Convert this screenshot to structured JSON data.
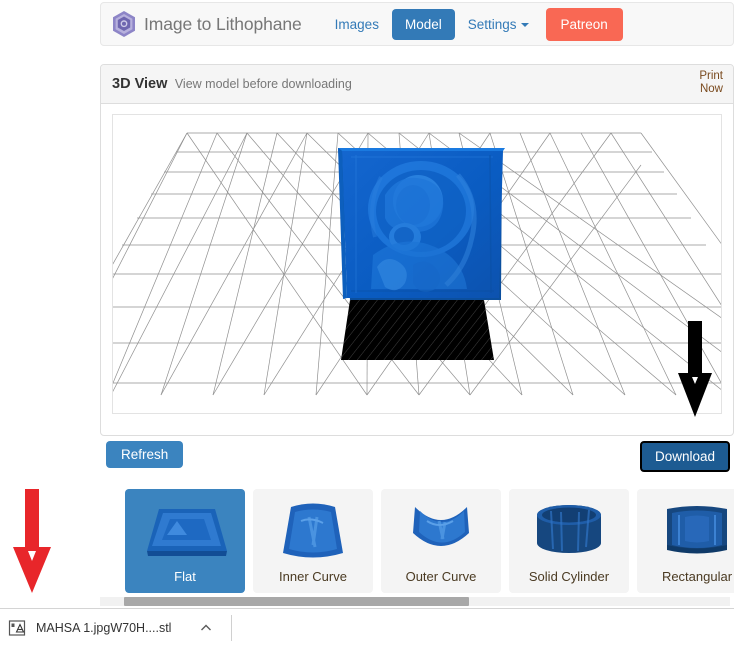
{
  "navbar": {
    "brand": "Image to Lithophane",
    "brand_icon": "hexagon-cube-logo",
    "items": [
      {
        "label": "Images",
        "kind": "link",
        "icon": ""
      },
      {
        "label": "Model",
        "kind": "button-active",
        "icon": ""
      },
      {
        "label": "Settings",
        "kind": "dropdown",
        "icon": "caret-down-icon"
      },
      {
        "label": "Patreon",
        "kind": "button-patreon",
        "icon": ""
      }
    ],
    "colors": {
      "active": "#337ab7",
      "link": "#337ab7",
      "patreon": "#f96854"
    }
  },
  "panel": {
    "title": "3D View",
    "subtitle": "View model before downloading",
    "print_now": "Print\nNow",
    "print_now_line1": "Print",
    "print_now_line2": "Now"
  },
  "viewer": {
    "description": "3D print bed wireframe grid with blue lithophane plate standing upright and black shadow base",
    "model_color": "#0a62c9",
    "grid_color": "#808080",
    "base_color": "#000000"
  },
  "actions": {
    "refresh_label": "Refresh",
    "download_label": "Download",
    "refresh_color": "#3b84bf",
    "download_color": "#1d5b92"
  },
  "shapes": {
    "selected": "Flat",
    "tiles": [
      {
        "label": "Flat",
        "icon": "flat-plate-thumb",
        "active": true
      },
      {
        "label": "Inner Curve",
        "icon": "inner-curve-thumb",
        "active": false
      },
      {
        "label": "Outer Curve",
        "icon": "outer-curve-thumb",
        "active": false
      },
      {
        "label": "Solid Cylinder",
        "icon": "solid-cylinder-thumb",
        "active": false
      },
      {
        "label": "Rectangular",
        "icon": "rectangular-thumb",
        "active": false
      }
    ]
  },
  "download_shelf": {
    "file_name": "MAHSA 1.jpgW70H....stl",
    "file_icon": "stl-file-icon",
    "chevron_icon": "chevron-up-icon"
  },
  "annotations": {
    "red_arrow": {
      "icon": "red-down-arrow",
      "color": "#e8262a"
    },
    "black_arrow": {
      "icon": "black-down-arrow",
      "color": "#000000"
    }
  }
}
